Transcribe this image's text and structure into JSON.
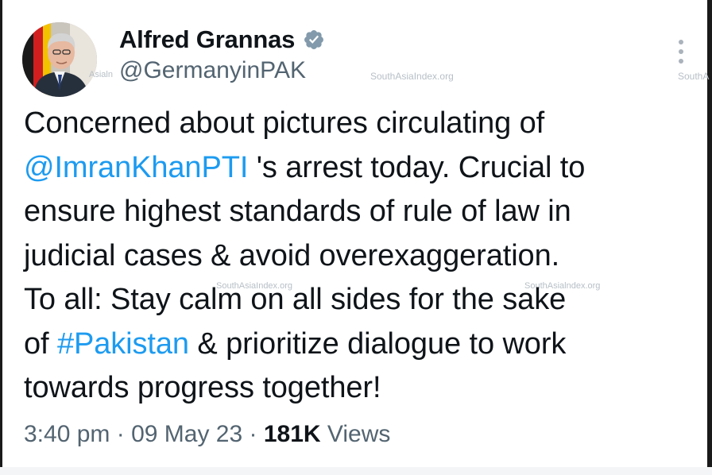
{
  "author": {
    "display_name": "Alfred Grannas",
    "handle": "@GermanyinPAK",
    "verified_icon": "verified-badge-icon"
  },
  "watermark": {
    "text": "SouthAsiaIndex.org",
    "partial_left": "Asialn",
    "partial_right": "SouthA",
    "partial_mid": "SouthAsialndex.org"
  },
  "tweet": {
    "line1": "Concerned about pictures circulating of",
    "mention": "@ImranKhanPTI",
    "line2_rest": " 's arrest today. Crucial to",
    "line3": "ensure highest standards of rule of law in",
    "line4": "judicial cases & avoid overexaggeration.",
    "line5": "To all: Stay calm on all sides for the sake",
    "line6_prefix": "of ",
    "hashtag": "#Pakistan",
    "line6_rest": " & prioritize dialogue to work",
    "line7": "towards progress together!"
  },
  "meta": {
    "time": "3:40 pm",
    "sep1": " · ",
    "date": "09 May 23",
    "sep2": " · ",
    "views_count": "181K",
    "views_label": " Views"
  },
  "colors": {
    "link": "#1d9bf0",
    "secondary_text": "#536471",
    "primary_text": "#0f1419",
    "verified": "#829aab"
  }
}
